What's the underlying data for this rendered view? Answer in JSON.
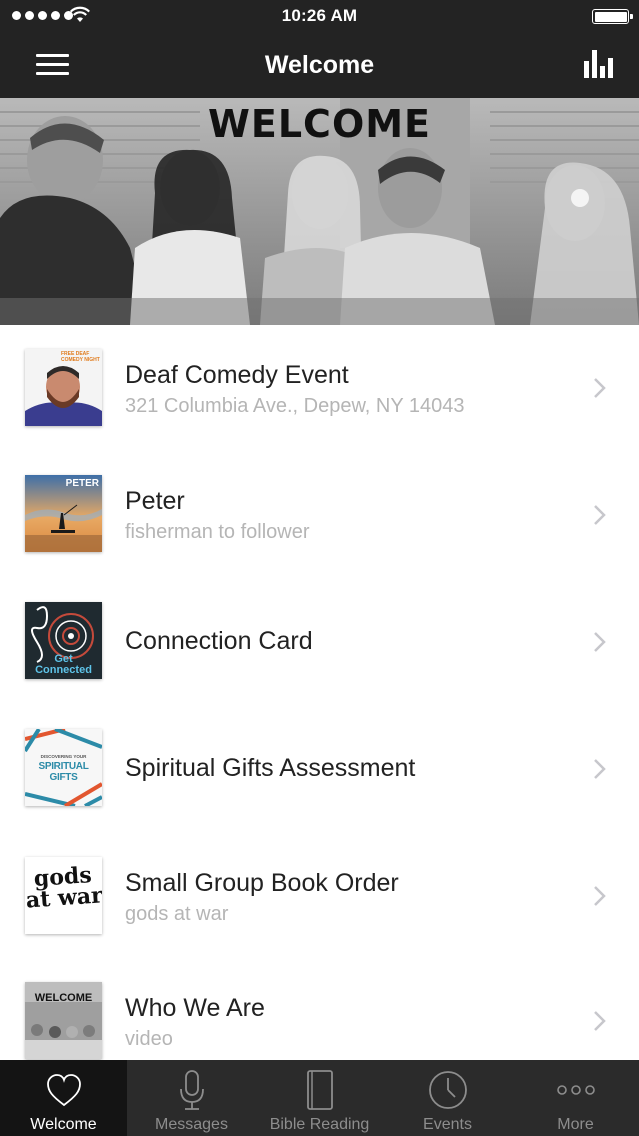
{
  "status_bar": {
    "time": "10:26 AM"
  },
  "nav": {
    "title": "Welcome"
  },
  "hero": {
    "banner_text": "WELCOME"
  },
  "list": {
    "items": [
      {
        "title": "Deaf Comedy Event",
        "subtitle": "321 Columbia Ave., Depew, NY 14043",
        "thumb": "deaf-comedy-thumbnail",
        "thumb_text": "FREE DEAF COMEDY NIGHT"
      },
      {
        "title": "Peter",
        "subtitle": "fisherman to follower",
        "thumb": "peter-thumbnail",
        "thumb_text": "PETER"
      },
      {
        "title": "Connection Card",
        "subtitle": "",
        "thumb": "get-connected-thumbnail",
        "thumb_text": "Get Connected"
      },
      {
        "title": "Spiritual Gifts Assessment",
        "subtitle": "",
        "thumb": "spiritual-gifts-thumbnail",
        "thumb_text": "SPIRITUAL GIFTS",
        "thumb_small_text": "DISCOVERING YOUR"
      },
      {
        "title": "Small Group Book Order",
        "subtitle": "gods at war",
        "thumb": "gods-at-war-thumbnail",
        "thumb_text": "gods at war"
      },
      {
        "title": "Who We Are",
        "subtitle": "video",
        "thumb": "welcome-photo-thumbnail",
        "thumb_text": "WELCOME"
      }
    ]
  },
  "tabs": [
    {
      "label": "Welcome",
      "icon": "heart-icon",
      "active": true
    },
    {
      "label": "Messages",
      "icon": "microphone-icon",
      "active": false
    },
    {
      "label": "Bible Reading",
      "icon": "book-icon",
      "active": false
    },
    {
      "label": "Events",
      "icon": "clock-icon",
      "active": false
    },
    {
      "label": "More",
      "icon": "more-dots-icon",
      "active": false
    }
  ],
  "colors": {
    "bar_background": "#232323",
    "tab_active_background": "#141414",
    "subtitle_text": "#b5b5b5",
    "chevron": "#c7c7cc"
  }
}
